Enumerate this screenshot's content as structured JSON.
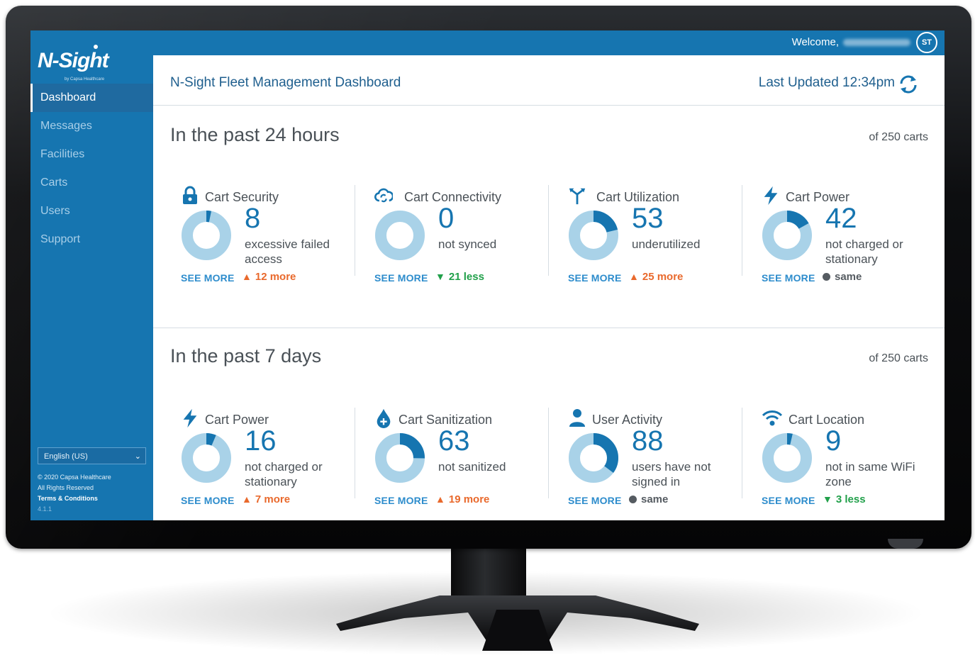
{
  "app": {
    "logo_text": "N-Sight",
    "logo_sub": "by Capsa Healthcare"
  },
  "sidebar": {
    "items": [
      {
        "label": "Dashboard",
        "active": true
      },
      {
        "label": "Messages",
        "active": false
      },
      {
        "label": "Facilities",
        "active": false
      },
      {
        "label": "Carts",
        "active": false
      },
      {
        "label": "Users",
        "active": false
      },
      {
        "label": "Support",
        "active": false
      }
    ],
    "language": "English (US)",
    "copyright": "© 2020 Capsa Healthcare",
    "rights": "All Rights Reserved",
    "terms": "Terms & Conditions",
    "version": "4.1.1"
  },
  "topbar": {
    "welcome": "Welcome,",
    "avatar_initials": "ST"
  },
  "header": {
    "title": "N-Sight Fleet Management Dashboard",
    "last_updated": "Last Updated 12:34pm"
  },
  "colors": {
    "brand_blue": "#1675b0",
    "donut_light": "#a9d2e8",
    "donut_dark": "#1675b0",
    "up": "#e9692c",
    "down": "#21a04a",
    "same": "#555b61"
  },
  "sections": [
    {
      "title": "In the past 24 hours",
      "of_carts": "of 250 carts",
      "cards": [
        {
          "icon": "lock-icon",
          "title": "Cart Security",
          "value": "8",
          "desc": "excessive failed access",
          "fraction": 0.032,
          "see_more": "SEE MORE",
          "trend": "12 more",
          "trend_dir": "up"
        },
        {
          "icon": "cloud-sync-icon",
          "title": "Cart Connectivity",
          "value": "0",
          "desc": "not synced",
          "fraction": 0.0,
          "see_more": "SEE MORE",
          "trend": "21 less",
          "trend_dir": "down"
        },
        {
          "icon": "split-arrows-icon",
          "title": "Cart Utilization",
          "value": "53",
          "desc": "underutilized",
          "fraction": 0.212,
          "see_more": "SEE MORE",
          "trend": "25 more",
          "trend_dir": "up"
        },
        {
          "icon": "lightning-icon",
          "title": "Cart Power",
          "value": "42",
          "desc": "not charged or stationary",
          "fraction": 0.168,
          "see_more": "SEE MORE",
          "trend": "same",
          "trend_dir": "same"
        }
      ]
    },
    {
      "title": "In the past 7 days",
      "of_carts": "of 250 carts",
      "cards": [
        {
          "icon": "lightning-icon",
          "title": "Cart Power",
          "value": "16",
          "desc": "not charged or stationary",
          "fraction": 0.064,
          "see_more": "SEE MORE",
          "trend": "7 more",
          "trend_dir": "up"
        },
        {
          "icon": "drop-plus-icon",
          "title": "Cart Sanitization",
          "value": "63",
          "desc": "not sanitized",
          "fraction": 0.252,
          "see_more": "SEE MORE",
          "trend": "19 more",
          "trend_dir": "up"
        },
        {
          "icon": "user-icon",
          "title": "User Activity",
          "value": "88",
          "desc": "users have not signed in",
          "fraction": 0.352,
          "see_more": "SEE MORE",
          "trend": "same",
          "trend_dir": "same"
        },
        {
          "icon": "wifi-icon",
          "title": "Cart Location",
          "value": "9",
          "desc": "not in same WiFi zone",
          "fraction": 0.036,
          "see_more": "SEE MORE",
          "trend": "3 less",
          "trend_dir": "down"
        }
      ]
    }
  ]
}
